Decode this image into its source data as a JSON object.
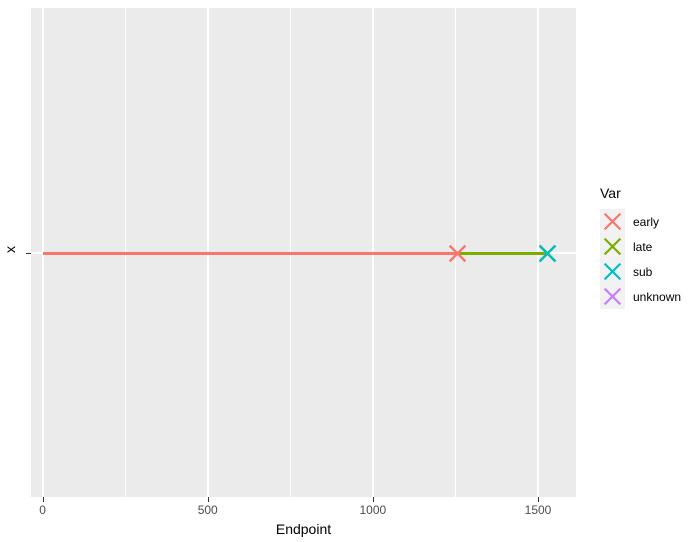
{
  "chart_data": {
    "type": "scatter",
    "title": "",
    "xlabel": "Endpoint",
    "ylabel": "x",
    "xlim": [
      -35,
      1615
    ],
    "x_ticks": [
      0,
      500,
      1000,
      1500
    ],
    "x_ticklabels": [
      "0",
      "500",
      "1000",
      "1500"
    ],
    "x_minor_ticks": [
      250,
      750,
      1250
    ],
    "y_categories": [
      "x"
    ],
    "grid": true,
    "legend": {
      "title": "Var",
      "position": "right",
      "entries": [
        {
          "label": "early",
          "color": "#F8766D",
          "marker": "x"
        },
        {
          "label": "late",
          "color": "#7CAE00",
          "marker": "x"
        },
        {
          "label": "sub",
          "color": "#00BFC4",
          "marker": "x"
        },
        {
          "label": "unknown",
          "color": "#C77CFF",
          "marker": "x"
        }
      ]
    },
    "series": [
      {
        "name": "early",
        "color": "#F8766D",
        "category": "x",
        "segment": {
          "x_start": 0,
          "x_end": 1255
        },
        "points": [
          {
            "x": 1255,
            "y": "x"
          }
        ]
      },
      {
        "name": "late",
        "color": "#7CAE00",
        "category": "x",
        "segment": {
          "x_start": 1255,
          "x_end": 1528
        },
        "points": [
          {
            "x": 1528,
            "y": "x"
          }
        ]
      },
      {
        "name": "sub",
        "color": "#00BFC4",
        "category": "x",
        "segment": null,
        "points": [
          {
            "x": 1528,
            "y": "x"
          }
        ]
      },
      {
        "name": "unknown",
        "color": "#C77CFF",
        "category": "x",
        "segment": null,
        "points": []
      }
    ],
    "colors": {
      "panel_background": "#EBEBEB",
      "grid_color": "#FFFFFF",
      "legend_key_background": "#F2F2F2",
      "axis_text": "#4D4D4D",
      "plot_background": "#FFFFFF"
    }
  }
}
